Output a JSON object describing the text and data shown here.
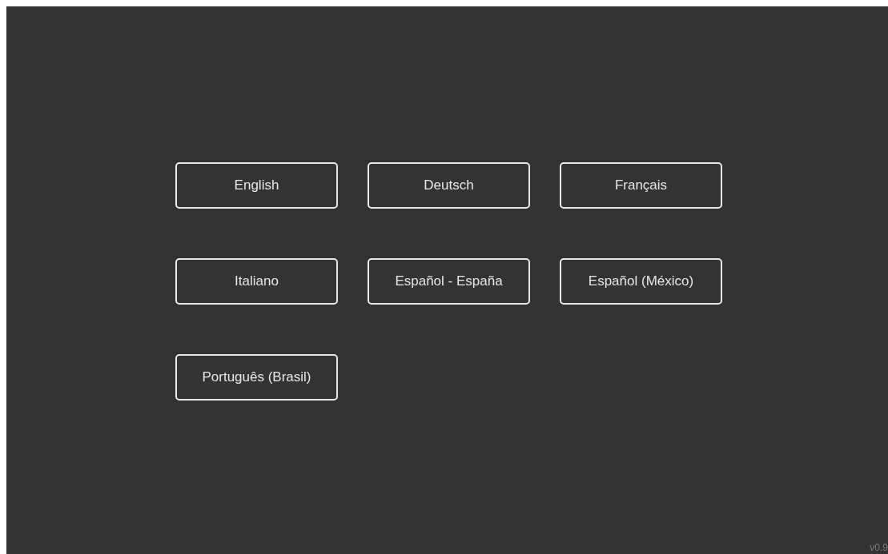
{
  "languages": [
    {
      "label": "English"
    },
    {
      "label": "Deutsch"
    },
    {
      "label": "Français"
    },
    {
      "label": "Italiano"
    },
    {
      "label": "Español - España"
    },
    {
      "label": "Español (México)"
    },
    {
      "label": "Português (Brasil)"
    }
  ],
  "version": "v0.9"
}
